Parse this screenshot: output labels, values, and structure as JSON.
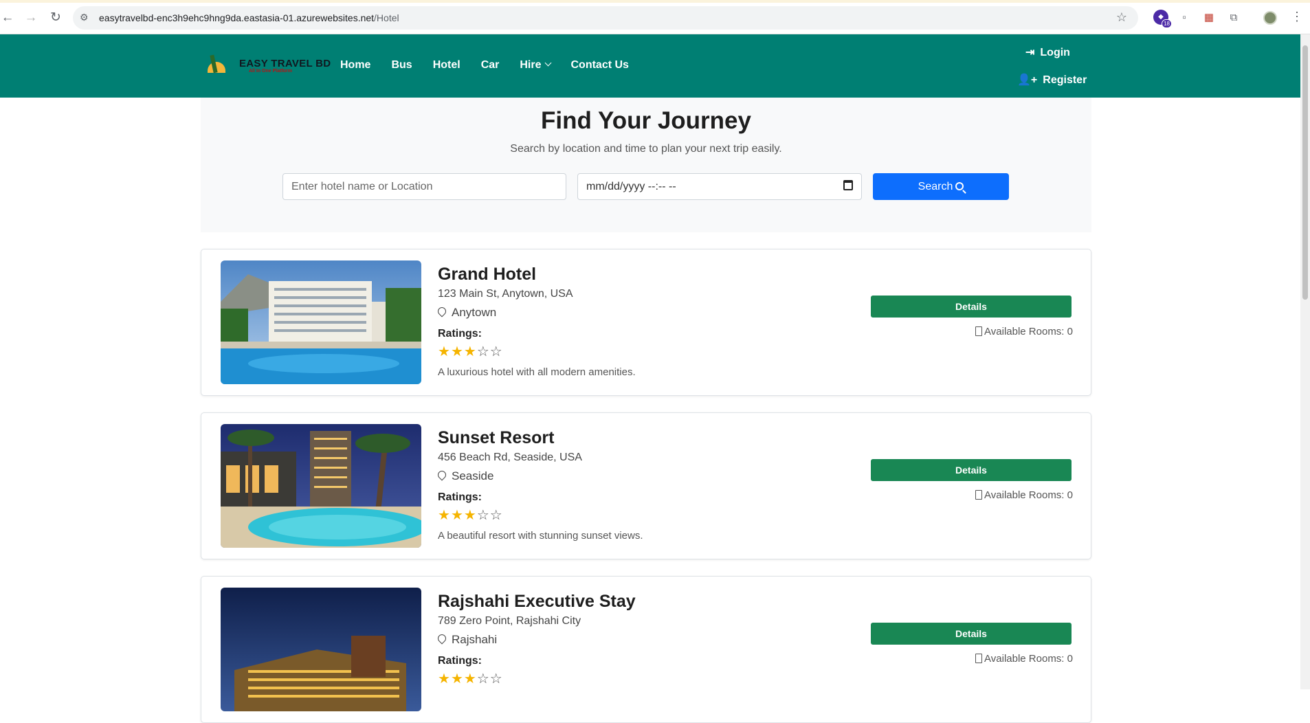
{
  "browser": {
    "url_host": "easytravelbd-enc3h9ehc9hng9da.eastasia-01.azurewebsites.net",
    "url_path": "/Hotel",
    "extension_badge_count": "18"
  },
  "header": {
    "logo_title": "EASY TRAVEL BD",
    "logo_subtitle": "All In One Platform",
    "nav": {
      "home": "Home",
      "bus": "Bus",
      "hotel": "Hotel",
      "car": "Car",
      "hire": "Hire",
      "contact": "Contact Us"
    },
    "login": "Login",
    "register": "Register"
  },
  "search": {
    "title": "Find Your Journey",
    "subtitle": "Search by location and time to plan your next trip easily.",
    "location_placeholder": "Enter hotel name or Location",
    "datetime_placeholder": "mm/dd/yyyy --:-- --",
    "button_label": "Search"
  },
  "hotels": [
    {
      "name": "Grand Hotel",
      "address": "123 Main St, Anytown, USA",
      "city": "Anytown",
      "ratings_label": "Ratings:",
      "rating": 3,
      "max_rating": 5,
      "description": "A luxurious hotel with all modern amenities.",
      "details_label": "Details",
      "rooms_text": "Available Rooms: 0"
    },
    {
      "name": "Sunset Resort",
      "address": "456 Beach Rd, Seaside, USA",
      "city": "Seaside",
      "ratings_label": "Ratings:",
      "rating": 3,
      "max_rating": 5,
      "description": "A beautiful resort with stunning sunset views.",
      "details_label": "Details",
      "rooms_text": "Available Rooms: 0"
    },
    {
      "name": "Rajshahi Executive Stay",
      "address": "789 Zero Point, Rajshahi City",
      "city": "Rajshahi",
      "ratings_label": "Ratings:",
      "rating": 3,
      "max_rating": 5,
      "description": "",
      "details_label": "Details",
      "rooms_text": "Available Rooms: 0"
    }
  ],
  "colors": {
    "header_bg": "#007f73",
    "search_button": "#0d6efd",
    "details_button": "#198754",
    "star": "#f5b400"
  }
}
